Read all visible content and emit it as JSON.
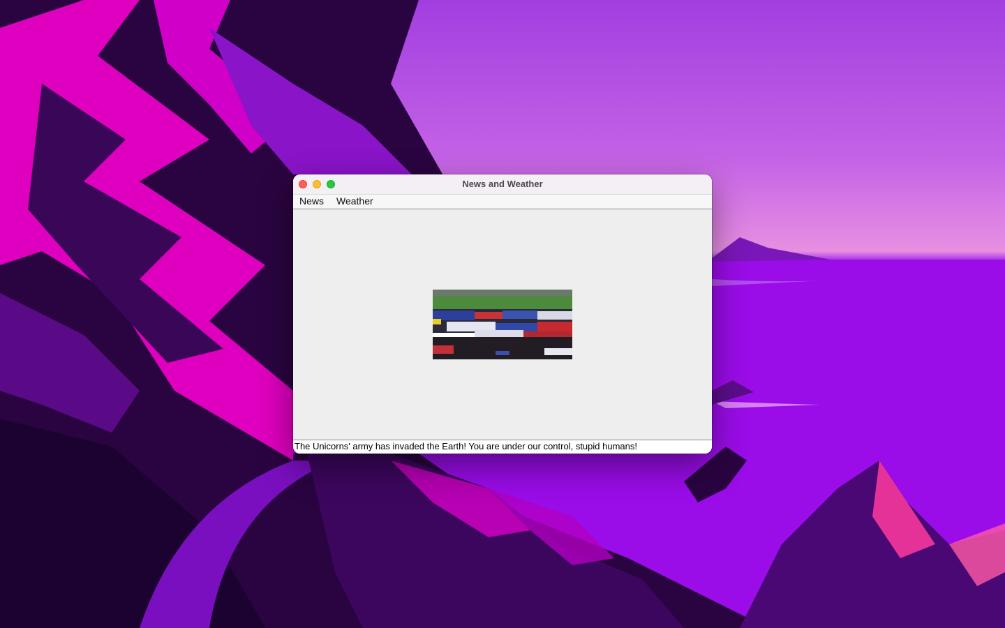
{
  "window": {
    "title": "News and Weather"
  },
  "menubar": {
    "items": [
      {
        "label": "News"
      },
      {
        "label": "Weather"
      }
    ]
  },
  "news": {
    "headline": "The Unicorns' army has invaded the Earth! You are under our control, stupid humans!"
  },
  "colors": {
    "close": "#fe5f57",
    "minimize": "#febc2e",
    "maximize": "#28c840",
    "window_bg": "#eeeeee"
  }
}
